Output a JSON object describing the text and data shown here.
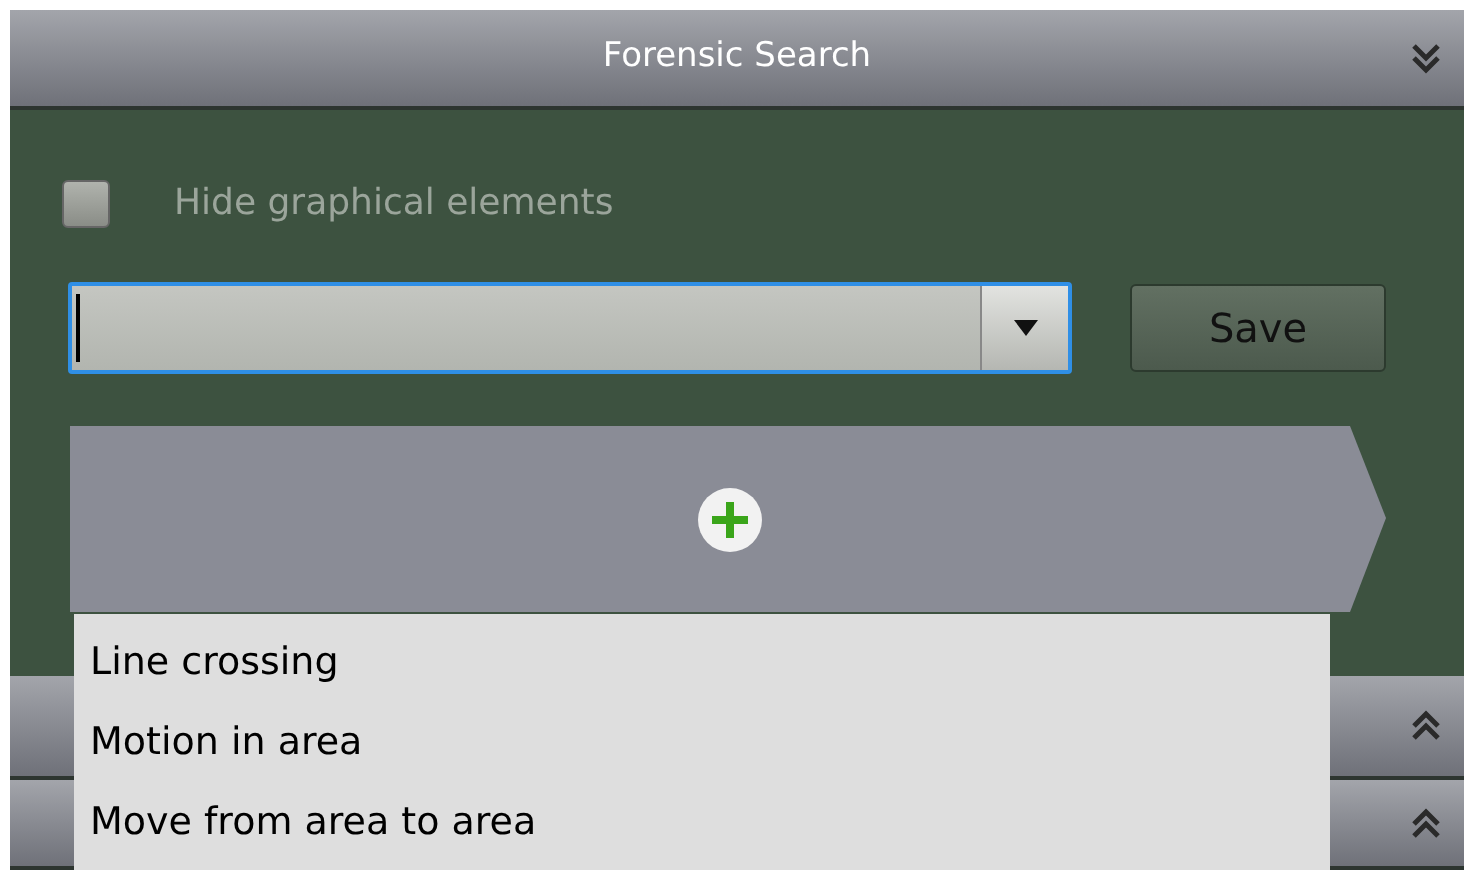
{
  "panels": [
    {
      "title": "Forensic Search",
      "expanded": true
    },
    {
      "expanded": false
    },
    {
      "expanded": false
    }
  ],
  "hide_graphics": {
    "label": "Hide graphical elements",
    "checked": false
  },
  "save_button": "Save",
  "menu": {
    "items": [
      "Line crossing",
      "Motion in area",
      "Move from area to area"
    ]
  }
}
